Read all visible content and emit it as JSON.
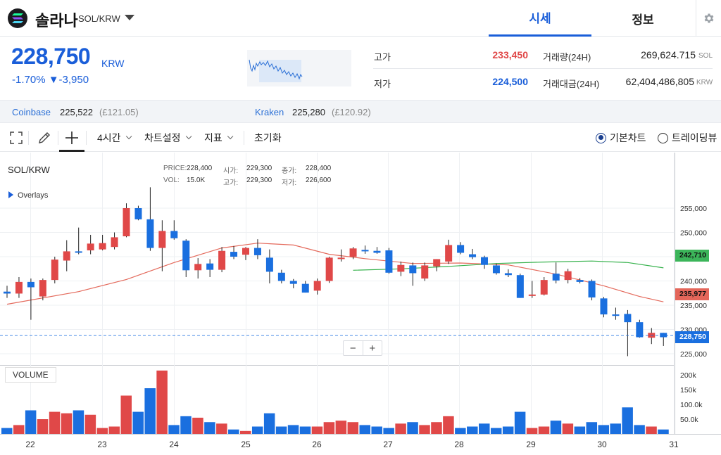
{
  "header": {
    "coin_name": "솔라나",
    "pair": "SOL/KRW",
    "tabs": [
      {
        "label": "시세"
      },
      {
        "label": "정보"
      }
    ]
  },
  "price": {
    "current": "228,750",
    "unit": "KRW",
    "change": "-1.70% ▼-3,950",
    "stats": {
      "high_label": "고가",
      "high_value": "233,450",
      "low_label": "저가",
      "low_value": "224,500",
      "volume_label": "거래량(24H)",
      "volume_value": "269,624.715",
      "volume_unit": "SOL",
      "amount_label": "거래대금(24H)",
      "amount_value": "62,404,486,805",
      "amount_unit": "KRW"
    }
  },
  "exchanges": [
    {
      "name": "Coinbase",
      "price": "225,522",
      "sub": "(£121.05)"
    },
    {
      "name": "Kraken",
      "price": "225,280",
      "sub": "(£120.92)"
    }
  ],
  "toolbar": {
    "interval": "4시간",
    "chart_settings": "차트설정",
    "indicators": "지표",
    "reset": "초기화",
    "view_basic": "기본차트",
    "view_tradingview": "트레이딩뷰"
  },
  "chart": {
    "symbol": "SOL/KRW",
    "overlays_label": "Overlays",
    "volume_label": "VOLUME",
    "ohlc": {
      "price_label": "PRICE:",
      "price": "228,400",
      "open_label": "시가:",
      "open": "229,300",
      "close_label": "종가:",
      "close": "228,400",
      "vol_label": "VOL:",
      "vol": "15.0K",
      "high_label": "고가:",
      "high": "229,300",
      "low_label": "저가:",
      "low": "226,600"
    },
    "tags": {
      "ma_green": "242,710",
      "ma_red": "235,977",
      "last": "228,750"
    },
    "colors": {
      "up": "#e04848",
      "down": "#1a6fdf",
      "ma_red": "#e46a5c",
      "ma_green": "#37b24d"
    }
  },
  "chart_data": {
    "type": "candlestick",
    "x_tick_labels": [
      "22",
      "23",
      "24",
      "25",
      "26",
      "27",
      "28",
      "29",
      "30",
      "31"
    ],
    "y_tick_labels": [
      "255,000",
      "250,000",
      "245,000",
      "240,000",
      "235,000",
      "230,000",
      "225,000"
    ],
    "y_range": [
      223000,
      259000
    ],
    "volume_tick_labels": [
      "200k",
      "150k",
      "100.0k",
      "50.0k"
    ],
    "volume_range": [
      0,
      220000
    ],
    "candles": [
      {
        "o": 237800,
        "h": 239000,
        "l": 236500,
        "c": 237400,
        "v": 20000
      },
      {
        "o": 237400,
        "h": 240800,
        "l": 236500,
        "c": 239800,
        "v": 30000
      },
      {
        "o": 239800,
        "h": 240500,
        "l": 232000,
        "c": 238700,
        "v": 80000
      },
      {
        "o": 236800,
        "h": 240500,
        "l": 236000,
        "c": 240200,
        "v": 50000
      },
      {
        "o": 240200,
        "h": 245000,
        "l": 239500,
        "c": 244400,
        "v": 75000
      },
      {
        "o": 244200,
        "h": 248400,
        "l": 242000,
        "c": 246100,
        "v": 70000
      },
      {
        "o": 246100,
        "h": 251000,
        "l": 245500,
        "c": 246000,
        "v": 80000
      },
      {
        "o": 246300,
        "h": 249500,
        "l": 245500,
        "c": 247700,
        "v": 65000
      },
      {
        "o": 246500,
        "h": 249500,
        "l": 246300,
        "c": 247800,
        "v": 20000
      },
      {
        "o": 247000,
        "h": 250000,
        "l": 246500,
        "c": 249000,
        "v": 25000
      },
      {
        "o": 249200,
        "h": 256000,
        "l": 249000,
        "c": 255000,
        "v": 130000
      },
      {
        "o": 255000,
        "h": 255500,
        "l": 252500,
        "c": 252700,
        "v": 75000
      },
      {
        "o": 252700,
        "h": 259300,
        "l": 246200,
        "c": 246800,
        "v": 155000
      },
      {
        "o": 246800,
        "h": 252500,
        "l": 242000,
        "c": 250300,
        "v": 215000
      },
      {
        "o": 250300,
        "h": 252500,
        "l": 248500,
        "c": 248800,
        "v": 30000
      },
      {
        "o": 248300,
        "h": 248600,
        "l": 240800,
        "c": 242200,
        "v": 60000
      },
      {
        "o": 242200,
        "h": 244700,
        "l": 240500,
        "c": 243500,
        "v": 55000
      },
      {
        "o": 243600,
        "h": 244500,
        "l": 240800,
        "c": 242300,
        "v": 40000
      },
      {
        "o": 242300,
        "h": 247000,
        "l": 241800,
        "c": 246200,
        "v": 35000
      },
      {
        "o": 246000,
        "h": 247200,
        "l": 244500,
        "c": 245000,
        "v": 15000
      },
      {
        "o": 245400,
        "h": 247000,
        "l": 244300,
        "c": 246800,
        "v": 10000
      },
      {
        "o": 246800,
        "h": 248600,
        "l": 244500,
        "c": 245300,
        "v": 25000
      },
      {
        "o": 244800,
        "h": 246500,
        "l": 239500,
        "c": 241900,
        "v": 70000
      },
      {
        "o": 241700,
        "h": 242300,
        "l": 239500,
        "c": 240000,
        "v": 25000
      },
      {
        "o": 240000,
        "h": 240400,
        "l": 238500,
        "c": 239400,
        "v": 30000
      },
      {
        "o": 239400,
        "h": 240000,
        "l": 237600,
        "c": 237600,
        "v": 25000
      },
      {
        "o": 238000,
        "h": 240500,
        "l": 237200,
        "c": 240000,
        "v": 25000
      },
      {
        "o": 240000,
        "h": 245000,
        "l": 239600,
        "c": 244800,
        "v": 40000
      },
      {
        "o": 244600,
        "h": 246500,
        "l": 244000,
        "c": 244800,
        "v": 45000
      },
      {
        "o": 245000,
        "h": 247000,
        "l": 244500,
        "c": 246700,
        "v": 40000
      },
      {
        "o": 246400,
        "h": 247300,
        "l": 245600,
        "c": 246100,
        "v": 30000
      },
      {
        "o": 246200,
        "h": 247000,
        "l": 245600,
        "c": 245800,
        "v": 25000
      },
      {
        "o": 246300,
        "h": 246800,
        "l": 241500,
        "c": 241700,
        "v": 20000
      },
      {
        "o": 241900,
        "h": 244000,
        "l": 241000,
        "c": 243300,
        "v": 35000
      },
      {
        "o": 243200,
        "h": 243800,
        "l": 239000,
        "c": 241600,
        "v": 40000
      },
      {
        "o": 240500,
        "h": 243800,
        "l": 240000,
        "c": 243200,
        "v": 30000
      },
      {
        "o": 243000,
        "h": 244500,
        "l": 242000,
        "c": 244500,
        "v": 40000
      },
      {
        "o": 244000,
        "h": 248500,
        "l": 243500,
        "c": 247400,
        "v": 60000
      },
      {
        "o": 247400,
        "h": 248000,
        "l": 245500,
        "c": 245800,
        "v": 20000
      },
      {
        "o": 245500,
        "h": 246600,
        "l": 244500,
        "c": 244900,
        "v": 25000
      },
      {
        "o": 244900,
        "h": 245200,
        "l": 242500,
        "c": 243300,
        "v": 35000
      },
      {
        "o": 243200,
        "h": 243600,
        "l": 241300,
        "c": 241600,
        "v": 20000
      },
      {
        "o": 241600,
        "h": 242400,
        "l": 240800,
        "c": 241200,
        "v": 25000
      },
      {
        "o": 241200,
        "h": 241500,
        "l": 236500,
        "c": 236500,
        "v": 75000
      },
      {
        "o": 237000,
        "h": 240000,
        "l": 236500,
        "c": 237200,
        "v": 20000
      },
      {
        "o": 237200,
        "h": 240800,
        "l": 237000,
        "c": 240200,
        "v": 25000
      },
      {
        "o": 241500,
        "h": 243800,
        "l": 239500,
        "c": 240100,
        "v": 45000
      },
      {
        "o": 240200,
        "h": 242500,
        "l": 239500,
        "c": 242000,
        "v": 35000
      },
      {
        "o": 240200,
        "h": 240600,
        "l": 239500,
        "c": 239800,
        "v": 25000
      },
      {
        "o": 240000,
        "h": 240300,
        "l": 236000,
        "c": 236600,
        "v": 40000
      },
      {
        "o": 236400,
        "h": 236700,
        "l": 232500,
        "c": 233100,
        "v": 30000
      },
      {
        "o": 233100,
        "h": 234500,
        "l": 232000,
        "c": 232800,
        "v": 35000
      },
      {
        "o": 233200,
        "h": 234000,
        "l": 224500,
        "c": 231500,
        "v": 90000
      },
      {
        "o": 231500,
        "h": 232000,
        "l": 228300,
        "c": 228400,
        "v": 30000
      },
      {
        "o": 228300,
        "h": 230300,
        "l": 227000,
        "c": 229300,
        "v": 25000
      },
      {
        "o": 229300,
        "h": 229300,
        "l": 226600,
        "c": 228400,
        "v": 15000
      }
    ],
    "ma_red": [
      [
        0,
        235200
      ],
      [
        6,
        237800
      ],
      [
        10,
        240300
      ],
      [
        14,
        243800
      ],
      [
        18,
        246800
      ],
      [
        21,
        247800
      ],
      [
        24,
        247400
      ],
      [
        27,
        245500
      ],
      [
        30,
        244600
      ],
      [
        34,
        243600
      ],
      [
        38,
        243700
      ],
      [
        42,
        243300
      ],
      [
        46,
        241400
      ],
      [
        50,
        239000
      ],
      [
        53,
        236800
      ],
      [
        55,
        235700
      ]
    ],
    "ma_green": [
      [
        29,
        242200
      ],
      [
        33,
        242500
      ],
      [
        37,
        243000
      ],
      [
        41,
        243600
      ],
      [
        45,
        243900
      ],
      [
        49,
        244100
      ],
      [
        52,
        243800
      ],
      [
        55,
        242700
      ]
    ]
  }
}
